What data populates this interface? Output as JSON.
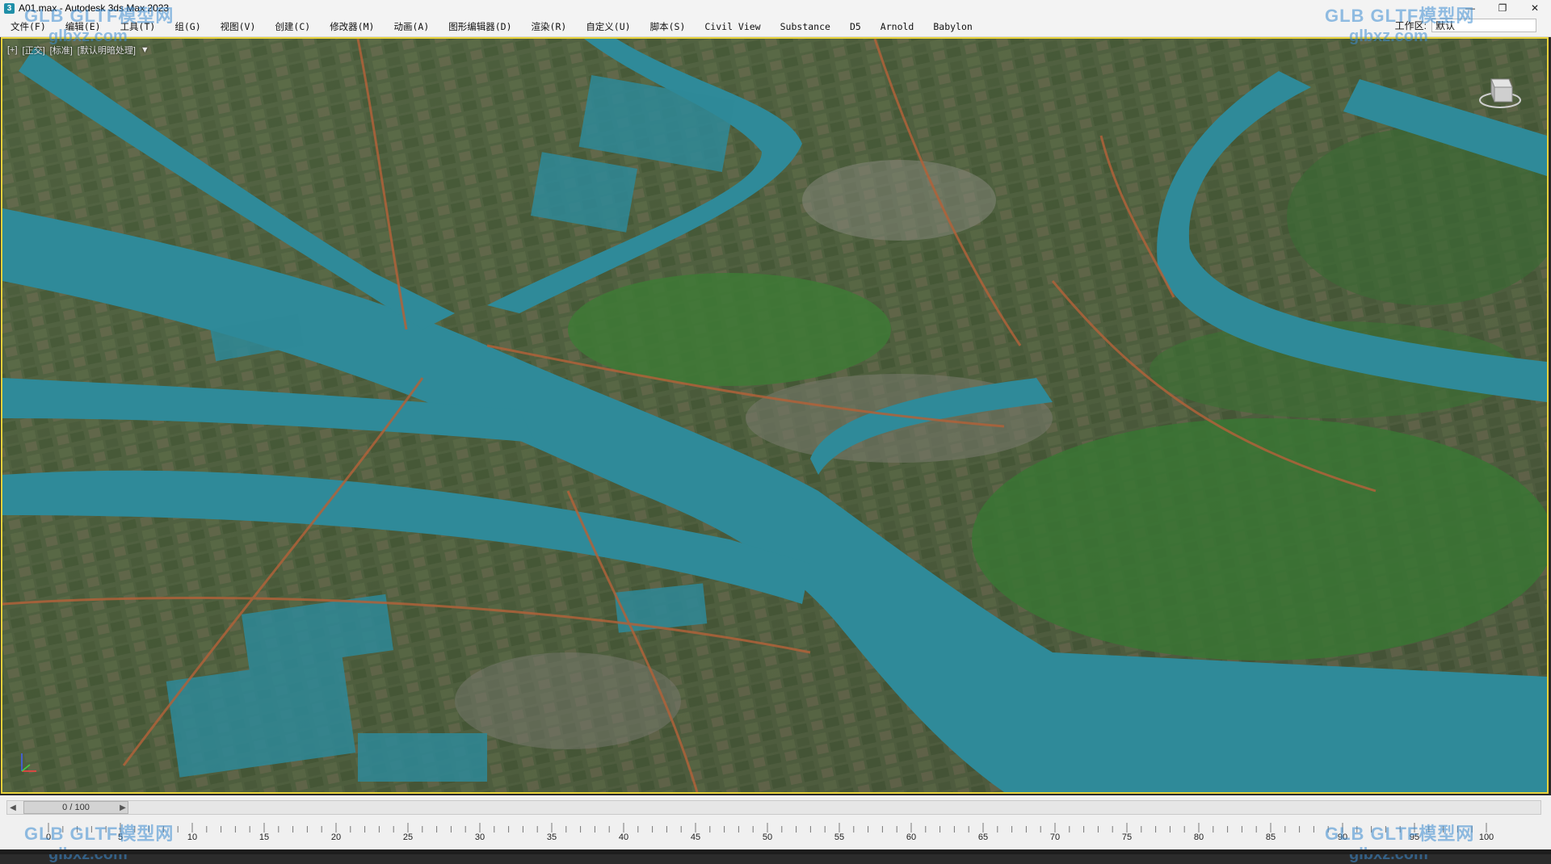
{
  "window": {
    "title": "A01.max - Autodesk 3ds Max 2023",
    "app_icon": "3",
    "controls": [
      "minimize-icon",
      "maximize-icon",
      "close-icon"
    ]
  },
  "menubar": {
    "items": [
      "文件(F)",
      "编辑(E)",
      "工具(T)",
      "组(G)",
      "视图(V)",
      "创建(C)",
      "修改器(M)",
      "动画(A)",
      "图形编辑器(D)",
      "渲染(R)",
      "自定义(U)",
      "脚本(S)",
      "Civil View",
      "Substance",
      "D5",
      "Arnold",
      "Babylon"
    ],
    "workspace_label": "工作区:",
    "workspace_value": "默认"
  },
  "viewport": {
    "label_plus": "[+]",
    "label_view": "[正交]",
    "label_shading": "[标准]",
    "label_lighting": "[默认明暗处理]",
    "filter_icon": "filter-icon",
    "colors": {
      "border_active": "#e8d23a",
      "water": "#2f8a99",
      "road": "#b0623a",
      "vegetation": "#3d6b34"
    }
  },
  "timeline": {
    "frame_readout": "0 / 100",
    "ticks": [
      "0",
      "5",
      "10",
      "15",
      "20",
      "25",
      "30",
      "35",
      "40",
      "45",
      "50",
      "55",
      "60",
      "65",
      "70",
      "75",
      "80",
      "85",
      "90",
      "95",
      "100"
    ]
  },
  "watermarks": {
    "top_left_a": "GLB GLTF模型网",
    "top_left_b": "glbxz.com",
    "top_right_a": "GLB GLTF模型网",
    "top_right_b": "glbxz.com",
    "bottom_left_a": "GLB GLTF模型网",
    "bottom_left_b": "glbxz.com",
    "bottom_right_a": "GLB GLTF模型网",
    "bottom_right_b": "glbxz.com"
  }
}
